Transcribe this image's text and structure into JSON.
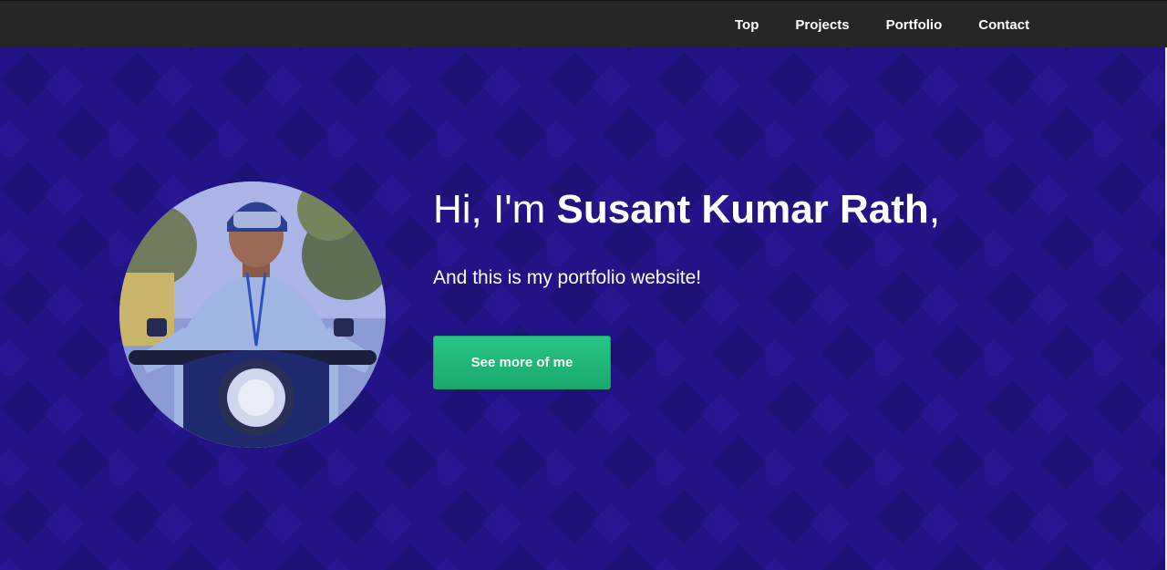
{
  "nav": {
    "items": [
      {
        "label": "Top"
      },
      {
        "label": "Projects"
      },
      {
        "label": "Portfolio"
      },
      {
        "label": "Contact"
      }
    ]
  },
  "hero": {
    "greeting_prefix": "Hi, I'm ",
    "name": "Susant Kumar Rath",
    "greeting_suffix": ",",
    "tagline": "And this is my portfolio website!",
    "cta_label": "See more of me"
  },
  "colors": {
    "navbar": "#262626",
    "hero_background": "#221486",
    "cta": "#1fb578"
  }
}
